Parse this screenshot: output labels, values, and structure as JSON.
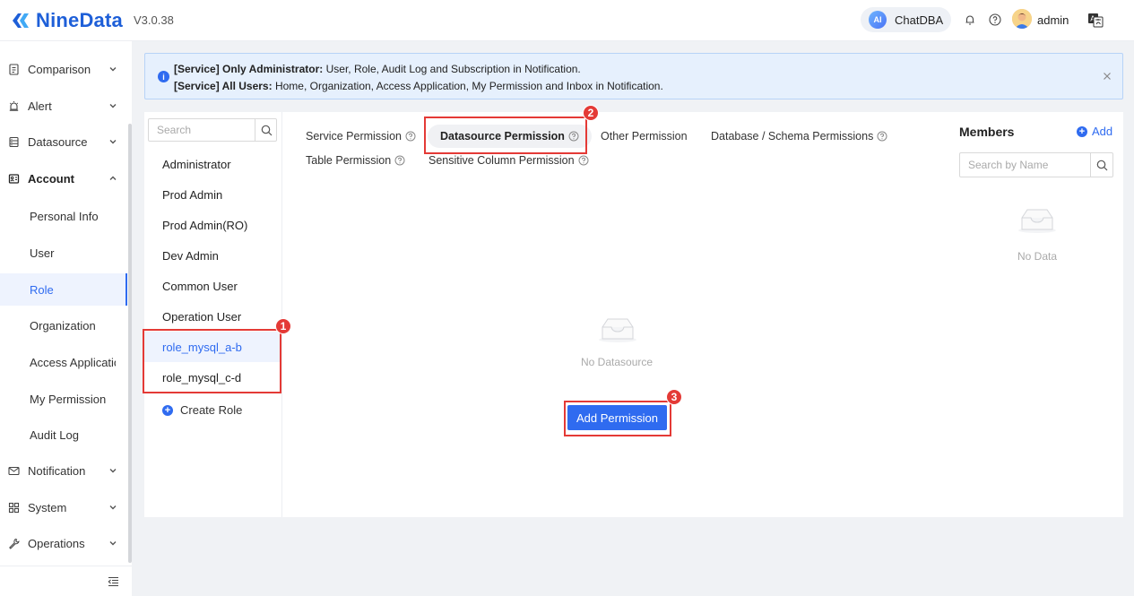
{
  "header": {
    "brand": "NineData",
    "version": "V3.0.38",
    "chatdba_badge": "AI",
    "chatdba_label": "ChatDBA",
    "user": "admin"
  },
  "sidebar": {
    "items": [
      {
        "label": "Comparison",
        "icon": "comparison-icon",
        "expanded": false
      },
      {
        "label": "Alert",
        "icon": "alert-icon",
        "expanded": false
      },
      {
        "label": "Datasource",
        "icon": "datasource-icon",
        "expanded": false
      },
      {
        "label": "Account",
        "icon": "account-icon",
        "expanded": true
      },
      {
        "label": "Notification",
        "icon": "mail-icon",
        "expanded": false
      },
      {
        "label": "System",
        "icon": "grid-icon",
        "expanded": false
      },
      {
        "label": "Operations",
        "icon": "wrench-icon",
        "expanded": false
      }
    ],
    "account_sub": [
      "Personal Info",
      "User",
      "Role",
      "Organization",
      "Access Application",
      "My Permission",
      "Audit Log"
    ],
    "active_sub": "Role"
  },
  "notice": {
    "line1_bold": "[Service] Only Administrator:",
    "line1_text": " User, Role, Audit Log and Subscription in Notification.",
    "line2_bold": "[Service] All Users:",
    "line2_text": " Home, Organization, Access Application, My Permission and Inbox in Notification."
  },
  "roles": {
    "search_placeholder": "Search",
    "items": [
      "Administrator",
      "Prod Admin",
      "Prod Admin(RO)",
      "Dev Admin",
      "Common User",
      "Operation User",
      "role_mysql_a-b",
      "role_mysql_c-d"
    ],
    "active": "role_mysql_a-b",
    "create_label": "Create Role"
  },
  "tabs": {
    "service": "Service Permission",
    "datasource": "Datasource Permission",
    "other": "Other Permission",
    "database_schema": "Database / Schema Permissions",
    "table": "Table Permission",
    "sensitive": "Sensitive Column Permission",
    "active": "Datasource Permission"
  },
  "content": {
    "empty_text": "No Datasource",
    "add_button": "Add Permission"
  },
  "members": {
    "title": "Members",
    "add_label": "Add",
    "search_placeholder": "Search by Name",
    "empty_text": "No Data"
  },
  "annotations": [
    "1",
    "2",
    "3"
  ],
  "colors": {
    "accent": "#2f6bf0",
    "annotation": "#e43a36",
    "notice_bg": "#e6f0fd"
  }
}
